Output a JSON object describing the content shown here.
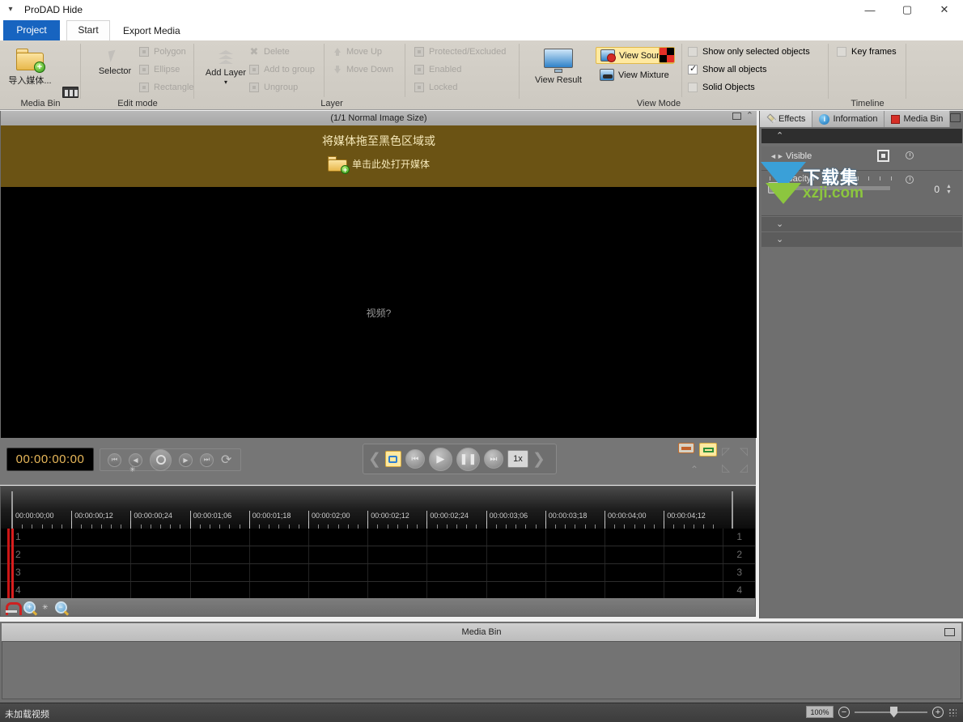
{
  "window": {
    "title": "ProDAD Hide",
    "quick_access_icon": "dropdown-icon",
    "minimize": "—",
    "maximize": "▢",
    "close": "✕"
  },
  "tabs": [
    {
      "id": "project",
      "label": "Project"
    },
    {
      "id": "start",
      "label": "Start"
    },
    {
      "id": "export",
      "label": "Export Media"
    }
  ],
  "help_icons": [
    {
      "name": "help-icon",
      "glyph": "?"
    },
    {
      "name": "information-icon",
      "glyph": "i"
    },
    {
      "name": "tip-icon",
      "glyph": "💡"
    },
    {
      "name": "collapse-ribbon-icon",
      "glyph": "⌃"
    }
  ],
  "ribbon": {
    "groups": [
      {
        "id": "media-bin",
        "label": "Media Bin",
        "import_label": "导入媒体...",
        "film_icon": "film-strip-icon"
      },
      {
        "id": "edit-mode",
        "label": "Edit mode",
        "selector_label": "Selector",
        "items": [
          {
            "label": "Polygon",
            "enabled": false
          },
          {
            "label": "Ellipse",
            "enabled": false
          },
          {
            "label": "Rectangle",
            "enabled": false
          }
        ]
      },
      {
        "id": "layer",
        "label": "Layer",
        "add_layer_label": "Add Layer",
        "items_a": [
          {
            "label": "Delete",
            "enabled": false
          },
          {
            "label": "Add to group",
            "enabled": false
          },
          {
            "label": "Ungroup",
            "enabled": false
          }
        ],
        "items_b": [
          {
            "label": "Move Up",
            "enabled": false
          },
          {
            "label": "Move Down",
            "enabled": false
          }
        ],
        "items_c": [
          {
            "label": "Protected/Excluded",
            "enabled": false,
            "checked": false
          },
          {
            "label": "Enabled",
            "enabled": false,
            "checked": false
          },
          {
            "label": "Locked",
            "enabled": false,
            "checked": false
          }
        ]
      },
      {
        "id": "view-mode",
        "label": "View Mode",
        "view_result_label": "View Result",
        "view_source_label": "View Source",
        "view_mixture_label": "View Mixture",
        "view_source_active": true,
        "checkboxes": [
          {
            "label": "Show only selected objects",
            "checked": false
          },
          {
            "label": "Show all objects",
            "checked": true
          },
          {
            "label": "Solid Objects",
            "checked": false
          }
        ]
      },
      {
        "id": "timeline",
        "label": "Timeline",
        "checkboxes": [
          {
            "label": "Key frames",
            "checked": false
          }
        ]
      }
    ]
  },
  "preview": {
    "header": "(1/1  Normal Image Size)",
    "drop_line1": "将媒体拖至黑色区域或",
    "drop_line2": "单击此处打开媒体",
    "stage_text": "视频?",
    "drop_bg": "#6b5314"
  },
  "transport": {
    "timecode": "00:00:00:00",
    "speed": "1x",
    "mini_buttons": [
      "skip-start-icon",
      "step-back-icon",
      "record-icon",
      "step-forward-icon",
      "skip-end-icon",
      "loop-icon"
    ],
    "main_buttons": [
      "loop-range-icon",
      "skip-start-icon",
      "play-icon",
      "pause-icon",
      "skip-end-icon"
    ]
  },
  "timeline": {
    "tick_labels": [
      "00:00:00;00",
      "00:00:00;12",
      "00:00:00;24",
      "00:00:01;06",
      "00:00:01;18",
      "00:00:02;00",
      "00:00:02;12",
      "00:00:02;24",
      "00:00:03;06",
      "00:00:03;18",
      "00:00:04;00",
      "00:00:04;12"
    ],
    "tracks": [
      "1",
      "2",
      "3",
      "4"
    ],
    "tools": [
      "magnet-icon",
      "zoom-in-icon",
      "zoom-out-icon"
    ]
  },
  "right_panel": {
    "tabs": [
      {
        "label": "Effects",
        "icon": "pencil-icon",
        "active": true
      },
      {
        "label": "Information",
        "icon": "info-icon",
        "active": false
      },
      {
        "label": "Media Bin",
        "icon": "red-square-icon",
        "active": false
      }
    ],
    "restore_icon": "restore-icon",
    "sections": [
      {
        "type": "collapse-up",
        "glyph": "⌃"
      },
      {
        "type": "property",
        "label": "Visible"
      },
      {
        "type": "property",
        "label": "Opacity",
        "value": "0"
      },
      {
        "type": "collapse-down",
        "glyph": "⌄"
      },
      {
        "type": "collapse-down",
        "glyph": "⌄"
      }
    ],
    "opacity_value": "0"
  },
  "watermark": {
    "line1": "下载集",
    "line2": "xzji.com"
  },
  "media_bin_panel": {
    "title": "Media Bin",
    "restore_icon": "restore-icon"
  },
  "status_bar": {
    "message": "未加载视频",
    "zoom_level": "100%",
    "zoom_out_glyph": "−",
    "zoom_in_glyph": "+"
  },
  "colors": {
    "accent_blue": "#1764c0",
    "highlight_yellow": "#ffe9a0",
    "drop_brown": "#6b5314",
    "playhead_red": "#d81e1e",
    "timecode_amber": "#e8b85a"
  }
}
